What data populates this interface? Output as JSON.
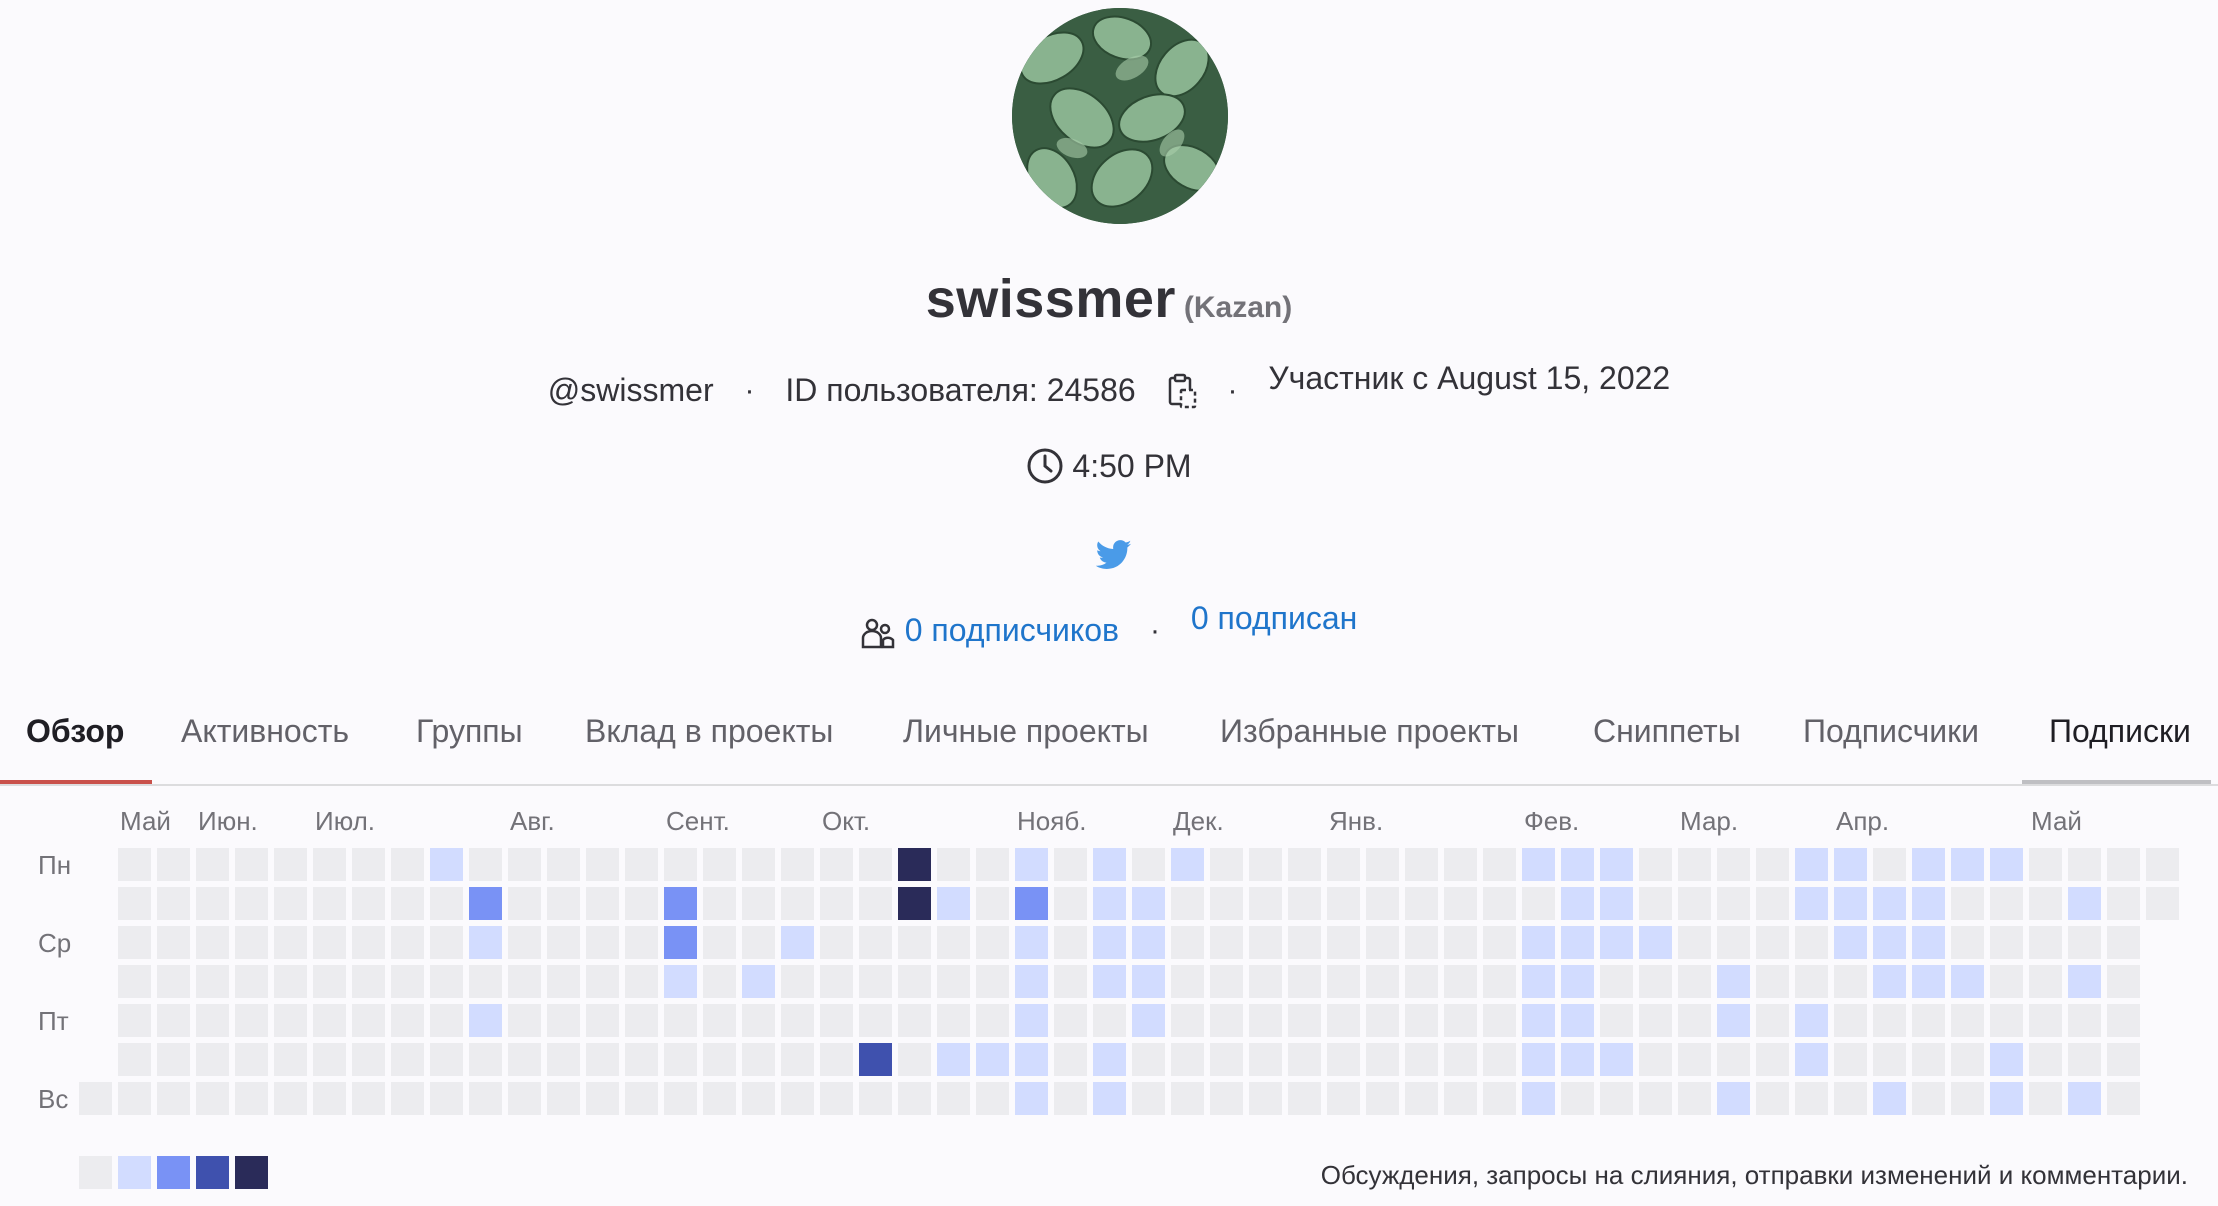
{
  "profile": {
    "username": "swissmer",
    "location": "(Kazan)",
    "handle": "@swissmer",
    "user_id_label": "ID пользователя: 24586",
    "member_since": "Участник с August 15, 2022",
    "local_time": "4:50 PM",
    "followers_link": "0 подписчиков",
    "following_link": "0 подписан",
    "separator": "·"
  },
  "tabs": [
    {
      "label": "Обзор",
      "active": true
    },
    {
      "label": "Активность",
      "active": false
    },
    {
      "label": "Группы",
      "active": false
    },
    {
      "label": "Вклад в проекты",
      "active": false
    },
    {
      "label": "Личные проекты",
      "active": false
    },
    {
      "label": "Избранные проекты",
      "active": false
    },
    {
      "label": "Сниппеты",
      "active": false
    },
    {
      "label": "Подписчики",
      "active": false
    },
    {
      "label": "Подписки",
      "active": false
    }
  ],
  "calendar": {
    "months": [
      {
        "label": "Май",
        "week": 1
      },
      {
        "label": "Июн.",
        "week": 3
      },
      {
        "label": "Июл.",
        "week": 6
      },
      {
        "label": "Авг.",
        "week": 11
      },
      {
        "label": "Сент.",
        "week": 15
      },
      {
        "label": "Окт.",
        "week": 19
      },
      {
        "label": "Нояб.",
        "week": 24
      },
      {
        "label": "Дек.",
        "week": 28
      },
      {
        "label": "Янв.",
        "week": 32
      },
      {
        "label": "Фев.",
        "week": 37
      },
      {
        "label": "Мар.",
        "week": 41
      },
      {
        "label": "Апр.",
        "week": 45
      },
      {
        "label": "Май",
        "week": 50
      }
    ],
    "days": [
      {
        "label": "Пн",
        "row": 0
      },
      {
        "label": "Ср",
        "row": 2
      },
      {
        "label": "Пт",
        "row": 4
      },
      {
        "label": "Вс",
        "row": 6
      }
    ],
    "weeks": 54,
    "first_week_start_row": 6,
    "last_week_rows": 2,
    "levels": [
      [
        9,
        0,
        1
      ],
      [
        10,
        1,
        2
      ],
      [
        10,
        2,
        1
      ],
      [
        10,
        4,
        1
      ],
      [
        15,
        1,
        2
      ],
      [
        15,
        2,
        2
      ],
      [
        15,
        3,
        1
      ],
      [
        17,
        3,
        1
      ],
      [
        18,
        2,
        1
      ],
      [
        20,
        5,
        3
      ],
      [
        21,
        0,
        4
      ],
      [
        21,
        1,
        4
      ],
      [
        22,
        1,
        1
      ],
      [
        22,
        5,
        1
      ],
      [
        23,
        5,
        1
      ],
      [
        24,
        0,
        1
      ],
      [
        24,
        1,
        2
      ],
      [
        24,
        2,
        1
      ],
      [
        24,
        3,
        1
      ],
      [
        24,
        4,
        1
      ],
      [
        24,
        5,
        1
      ],
      [
        24,
        6,
        1
      ],
      [
        26,
        0,
        1
      ],
      [
        26,
        1,
        1
      ],
      [
        26,
        2,
        1
      ],
      [
        26,
        3,
        1
      ],
      [
        26,
        5,
        1
      ],
      [
        26,
        6,
        1
      ],
      [
        27,
        1,
        1
      ],
      [
        27,
        2,
        1
      ],
      [
        27,
        3,
        1
      ],
      [
        27,
        4,
        1
      ],
      [
        28,
        0,
        1
      ],
      [
        37,
        0,
        1
      ],
      [
        37,
        2,
        1
      ],
      [
        37,
        3,
        1
      ],
      [
        37,
        4,
        1
      ],
      [
        37,
        5,
        1
      ],
      [
        37,
        6,
        1
      ],
      [
        38,
        0,
        1
      ],
      [
        38,
        1,
        1
      ],
      [
        38,
        2,
        1
      ],
      [
        38,
        3,
        1
      ],
      [
        38,
        4,
        1
      ],
      [
        38,
        5,
        1
      ],
      [
        39,
        0,
        1
      ],
      [
        39,
        1,
        1
      ],
      [
        39,
        2,
        1
      ],
      [
        39,
        5,
        1
      ],
      [
        40,
        2,
        1
      ],
      [
        42,
        3,
        1
      ],
      [
        42,
        4,
        1
      ],
      [
        42,
        6,
        1
      ],
      [
        44,
        0,
        1
      ],
      [
        44,
        1,
        1
      ],
      [
        44,
        4,
        1
      ],
      [
        44,
        5,
        1
      ],
      [
        45,
        0,
        1
      ],
      [
        45,
        1,
        1
      ],
      [
        45,
        2,
        1
      ],
      [
        46,
        1,
        1
      ],
      [
        46,
        2,
        1
      ],
      [
        46,
        3,
        1
      ],
      [
        46,
        6,
        1
      ],
      [
        47,
        0,
        1
      ],
      [
        47,
        1,
        1
      ],
      [
        47,
        2,
        1
      ],
      [
        47,
        3,
        1
      ],
      [
        48,
        0,
        1
      ],
      [
        48,
        3,
        1
      ],
      [
        49,
        0,
        1
      ],
      [
        49,
        5,
        1
      ],
      [
        49,
        6,
        1
      ],
      [
        51,
        1,
        1
      ],
      [
        51,
        3,
        1
      ],
      [
        51,
        6,
        1
      ]
    ],
    "legend_text": "Обсуждения, запросы на слияния, отправки изменений и комментарии."
  }
}
